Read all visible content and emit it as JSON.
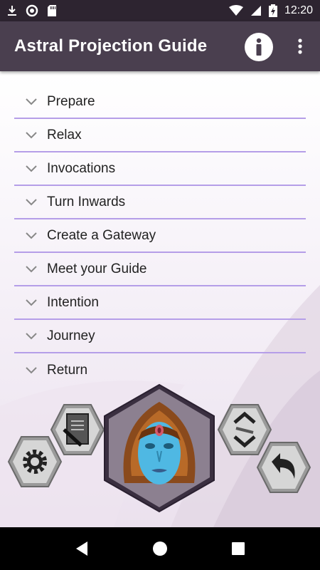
{
  "status_bar": {
    "time": "12:20",
    "icons": [
      "download-icon",
      "sync-icon",
      "sd-card-icon",
      "wifi-icon",
      "signal-icon",
      "battery-icon"
    ]
  },
  "app_bar": {
    "title": "Astral Projection Guide",
    "info_icon": "info-icon",
    "overflow_icon": "more-vert-icon"
  },
  "menu": {
    "items": [
      {
        "label": "Prepare"
      },
      {
        "label": "Relax"
      },
      {
        "label": "Invocations"
      },
      {
        "label": "Turn Inwards"
      },
      {
        "label": "Create a Gateway"
      },
      {
        "label": "Meet your Guide"
      },
      {
        "label": "Intention"
      },
      {
        "label": "Journey"
      },
      {
        "label": "Return"
      }
    ],
    "divider_color": "#b59ee8"
  },
  "bottom_controls": {
    "settings_icon": "gear-icon",
    "notes_icon": "notepad-pencil-icon",
    "avatar": "guide-face-avatar",
    "collapse_icon": "expand-collapse-icon",
    "back_icon": "undo-arrow-icon"
  },
  "nav_bar": {
    "icons": [
      "back-triangle-icon",
      "home-circle-icon",
      "recents-square-icon"
    ]
  },
  "colors": {
    "app_bar": "#4a3f4f",
    "status_bar": "#2d2430",
    "accent": "#b59ee8"
  }
}
